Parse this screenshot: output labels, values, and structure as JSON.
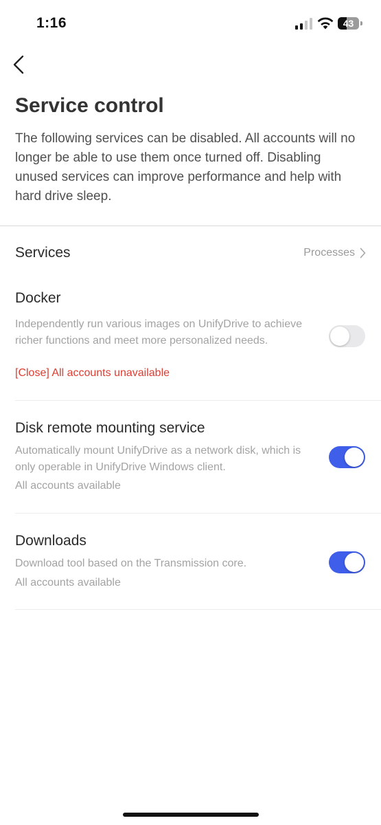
{
  "status_bar": {
    "time": "1:16",
    "battery_percent": "43",
    "battery_level": 0.43,
    "signal_bars_active": 2,
    "icons": [
      "cellular-signal-icon",
      "wifi-icon",
      "battery-icon"
    ]
  },
  "header": {
    "back_icon": "chevron-left-icon",
    "title": "Service control",
    "description": "The following services can be disabled. All accounts will no longer be able to use them once turned off. Disabling unused services can improve performance and help with hard drive sleep."
  },
  "section": {
    "title": "Services",
    "processes_label": "Processes",
    "processes_icon": "chevron-right-icon"
  },
  "services": [
    {
      "name": "Docker",
      "description": "Independently run various images on UnifyDrive to achieve richer functions and meet more personalized needs.",
      "status": "[Close] All accounts unavailable",
      "enabled": false
    },
    {
      "name": "Disk remote mounting service",
      "description": "Automatically mount UnifyDrive as a network disk, which is only operable in UnifyDrive Windows client.",
      "status": "All accounts available",
      "enabled": true
    },
    {
      "name": "Downloads",
      "description": "Download tool based on the Transmission core.",
      "status": "All accounts available",
      "enabled": true
    }
  ],
  "colors": {
    "accent": "#3f5ee9",
    "error": "#e03b2f",
    "toggle_off": "#e9e9eb"
  }
}
